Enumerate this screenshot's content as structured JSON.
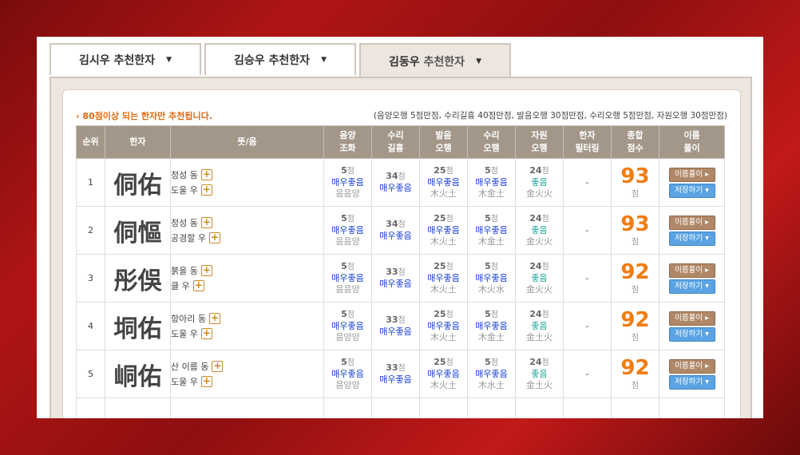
{
  "tabs": [
    {
      "name": "김시우",
      "suffix": "추천한자",
      "caret": "▼",
      "active": false
    },
    {
      "name": "김승우",
      "suffix": "추천한자",
      "caret": "▼",
      "active": false
    },
    {
      "name": "김동우",
      "suffix": "추천한자",
      "caret": "▼",
      "active": true
    }
  ],
  "notice": "› 80점이상 되는 한자만 추천됩니다.",
  "scoring_note": "(음양오행 5점만점, 수리길흉 40점만점, 발음오행 30점만점, 수리오행 5점만점, 자원오행 30점만점)",
  "headers": [
    "순위",
    "한자",
    "뜻/음",
    "음양\n조화",
    "수리\n길흉",
    "발음\n오행",
    "수리\n오행",
    "자원\n오행",
    "한자\n필터링",
    "종합\n점수",
    "이름\n풀이"
  ],
  "unit_score": "점",
  "buttons": {
    "interpret": "이름풀이 ▸",
    "save": "저장하기 ▾"
  },
  "rows": [
    {
      "rank": "1",
      "hanja": "侗佑",
      "meanings": [
        {
          "text": "정성 동",
          "plus": "+"
        },
        {
          "text": "도울 우",
          "plus": "+"
        }
      ],
      "eumyang": {
        "score": "5",
        "grade": "매우좋음",
        "detail": "음음양"
      },
      "suri": {
        "score": "34",
        "grade": "매우좋음"
      },
      "bareum": {
        "score": "25",
        "grade": "매우좋음",
        "detail": "木火土"
      },
      "suriohaeng": {
        "score": "5",
        "grade": "매우좋음",
        "detail": "木金土"
      },
      "jawon": {
        "score": "24",
        "grade": "좋음",
        "detail": "金火火"
      },
      "filter": "-",
      "total": "93"
    },
    {
      "rank": "2",
      "hanja": "侗慪",
      "meanings": [
        {
          "text": "정성 동",
          "plus": "+"
        },
        {
          "text": "공경할 우",
          "plus": "+"
        }
      ],
      "eumyang": {
        "score": "5",
        "grade": "매우좋음",
        "detail": "음음양"
      },
      "suri": {
        "score": "34",
        "grade": "매우좋음"
      },
      "bareum": {
        "score": "25",
        "grade": "매우좋음",
        "detail": "木火土"
      },
      "suriohaeng": {
        "score": "5",
        "grade": "매우좋음",
        "detail": "木金土"
      },
      "jawon": {
        "score": "24",
        "grade": "좋음",
        "detail": "金火火"
      },
      "filter": "-",
      "total": "93"
    },
    {
      "rank": "3",
      "hanja": "彤俁",
      "meanings": [
        {
          "text": "붉을 동",
          "plus": "+"
        },
        {
          "text": "클 우",
          "plus": "+"
        }
      ],
      "eumyang": {
        "score": "5",
        "grade": "매우좋음",
        "detail": "음음양"
      },
      "suri": {
        "score": "33",
        "grade": "매우좋음"
      },
      "bareum": {
        "score": "25",
        "grade": "매우좋음",
        "detail": "木火土"
      },
      "suriohaeng": {
        "score": "5",
        "grade": "매우좋음",
        "detail": "木火水"
      },
      "jawon": {
        "score": "24",
        "grade": "좋음",
        "detail": "金火火"
      },
      "filter": "-",
      "total": "92"
    },
    {
      "rank": "4",
      "hanja": "垌佑",
      "meanings": [
        {
          "text": "항아리 동",
          "plus": "+"
        },
        {
          "text": "도울 우",
          "plus": "+"
        }
      ],
      "eumyang": {
        "score": "5",
        "grade": "매우좋음",
        "detail": "음양양"
      },
      "suri": {
        "score": "33",
        "grade": "매우좋음"
      },
      "bareum": {
        "score": "25",
        "grade": "매우좋음",
        "detail": "木火土"
      },
      "suriohaeng": {
        "score": "5",
        "grade": "매우좋음",
        "detail": "木金土"
      },
      "jawon": {
        "score": "24",
        "grade": "좋음",
        "detail": "金土火"
      },
      "filter": "-",
      "total": "92"
    },
    {
      "rank": "5",
      "hanja": "峒佑",
      "meanings": [
        {
          "text": "산 이름 동",
          "plus": "+"
        },
        {
          "text": "도울 우",
          "plus": "+"
        }
      ],
      "eumyang": {
        "score": "5",
        "grade": "매우좋음",
        "detail": "음양양"
      },
      "suri": {
        "score": "33",
        "grade": "매우좋음"
      },
      "bareum": {
        "score": "25",
        "grade": "매우좋음",
        "detail": "木火土"
      },
      "suriohaeng": {
        "score": "5",
        "grade": "매우좋음",
        "detail": "木水土"
      },
      "jawon": {
        "score": "24",
        "grade": "좋음",
        "detail": "金土火"
      },
      "filter": "-",
      "total": "92"
    }
  ]
}
